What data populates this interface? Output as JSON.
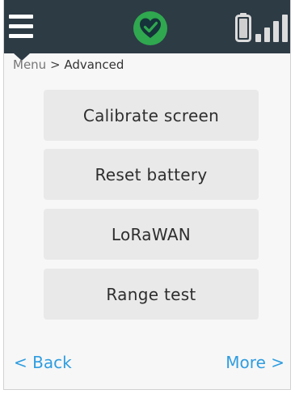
{
  "header": {
    "menu_icon": "hamburger-menu-icon",
    "status_icon": "heart-check-icon",
    "status_color": "#2fa84f",
    "battery_icon": "battery-icon",
    "signal_icon": "signal-bars-icon",
    "background_color": "#2d3b45"
  },
  "breadcrumb": {
    "root": "Menu",
    "separator": ">",
    "current": "Advanced"
  },
  "actions": [
    {
      "label": "Calibrate screen"
    },
    {
      "label": "Reset battery"
    },
    {
      "label": "LoRaWAN"
    },
    {
      "label": "Range test"
    }
  ],
  "footer": {
    "back_label": "< Back",
    "more_label": "More >",
    "link_color": "#2f9de0"
  }
}
